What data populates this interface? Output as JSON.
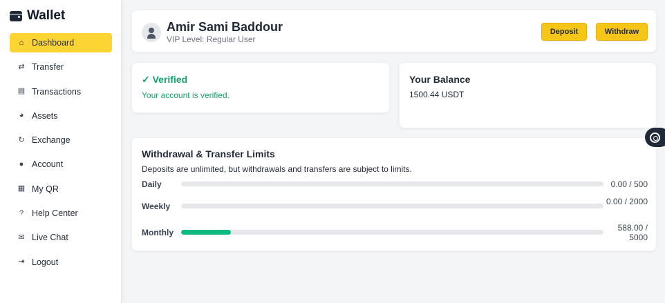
{
  "app": {
    "title": "Wallet"
  },
  "sidebar": {
    "items": [
      {
        "label": "Dashboard",
        "icon": "home-icon",
        "glyph": "⌂"
      },
      {
        "label": "Transfer",
        "icon": "swap-arrows-icon",
        "glyph": "⇄"
      },
      {
        "label": "Transactions",
        "icon": "receipt-icon",
        "glyph": "▤"
      },
      {
        "label": "Assets",
        "icon": "pie-chart-icon",
        "glyph": "◕"
      },
      {
        "label": "Exchange",
        "icon": "refresh-icon",
        "glyph": "↻"
      },
      {
        "label": "Account",
        "icon": "user-icon",
        "glyph": "●"
      },
      {
        "label": "My QR",
        "icon": "qr-code-icon",
        "glyph": "▦"
      },
      {
        "label": "Help Center",
        "icon": "question-circle-icon",
        "glyph": "?"
      },
      {
        "label": "Live Chat",
        "icon": "chat-bubbles-icon",
        "glyph": "✉"
      },
      {
        "label": "Logout",
        "icon": "logout-icon",
        "glyph": "⇥"
      }
    ],
    "active_index": 0
  },
  "profile": {
    "name": "Amir Sami Baddour",
    "vip_level": "VIP Level: Regular User",
    "deposit_label": "Deposit",
    "withdraw_label": "Withdraw"
  },
  "verification": {
    "title": "✓ Verified",
    "text": "Your account is verified."
  },
  "balance": {
    "title": "Your Balance",
    "value": "1500.44 USDT"
  },
  "limits": {
    "title": "Withdrawal & Transfer Limits",
    "description": "Deposits are unlimited, but withdrawals and transfers are subject to limits.",
    "rows": [
      {
        "label": "Daily",
        "value": "0.00 / 500",
        "used": 0,
        "max": 500
      },
      {
        "label": "Weekly",
        "value": "0.00 / 2000",
        "used": 0,
        "max": 2000
      },
      {
        "label": "Monthly",
        "value": "588.00 / 5000",
        "used": 588,
        "max": 5000
      }
    ]
  },
  "colors": {
    "accent": "#fcd535",
    "button": "#f5c518",
    "success": "#16a36a",
    "progress": "#10b981"
  }
}
